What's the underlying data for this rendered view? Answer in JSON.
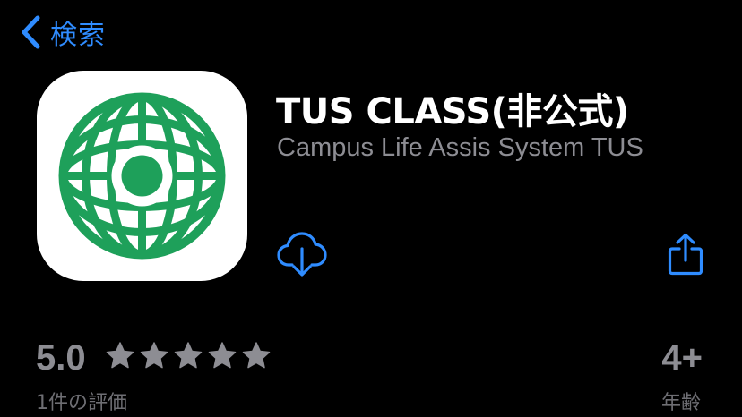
{
  "nav": {
    "back_label": "検索"
  },
  "app": {
    "title": "TUS CLASS(非公式)",
    "subtitle": "Campus Life Assis System TUS",
    "icon_name": "globe-logo-icon",
    "brand_color": "#1ea05a"
  },
  "actions": {
    "download_icon": "cloud-download-icon",
    "share_icon": "share-icon",
    "accent_color": "#2f8cff"
  },
  "ratings": {
    "value": "5.0",
    "stars": 5,
    "count_label": "1件の評価"
  },
  "age": {
    "value": "4+",
    "label": "年齢"
  }
}
